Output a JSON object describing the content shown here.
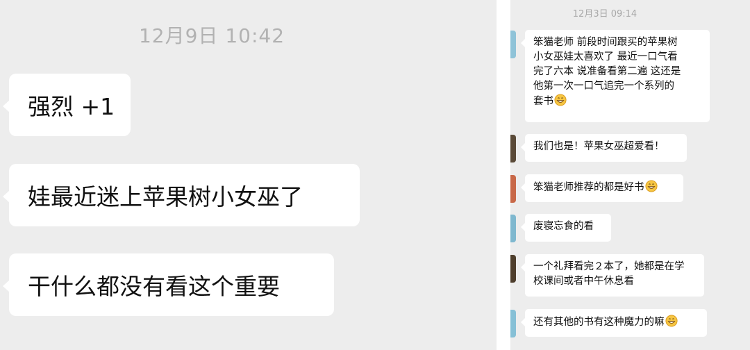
{
  "left": {
    "timestamp": "12月9日 10:42",
    "messages": [
      {
        "text": "强烈 +1"
      },
      {
        "text": "娃最近迷上苹果树小女巫了"
      },
      {
        "text": "干什么都没有看这个重要"
      }
    ]
  },
  "right": {
    "timestamp": "12月3日 09:14",
    "messages": [
      {
        "lines": [
          "笨猫老师 前段时间跟买的苹果树",
          "小女巫娃太喜欢了  最近一口气看",
          "完了六本 说准备看第二遍 这还是",
          "他第一次一口气追完一个系列的",
          "套书"
        ]
      },
      {
        "lines": [
          "我们也是！苹果女巫超爱看！"
        ]
      },
      {
        "lines": [
          "笨猫老师推荐的都是好书"
        ]
      },
      {
        "lines": [
          "废寝忘食的看"
        ]
      },
      {
        "lines": [
          "一个礼拜看完２本了，她都是在学",
          "校课间或者中午休息看"
        ]
      },
      {
        "lines": [
          "还有其他的书有这种魔力的嘛"
        ]
      }
    ]
  },
  "emoji": "grinning-face-icon",
  "colors": {
    "chat_background": "#ededed",
    "bubble": "#ffffff",
    "text": "#111111",
    "timestamp": "#b2b2b2"
  }
}
